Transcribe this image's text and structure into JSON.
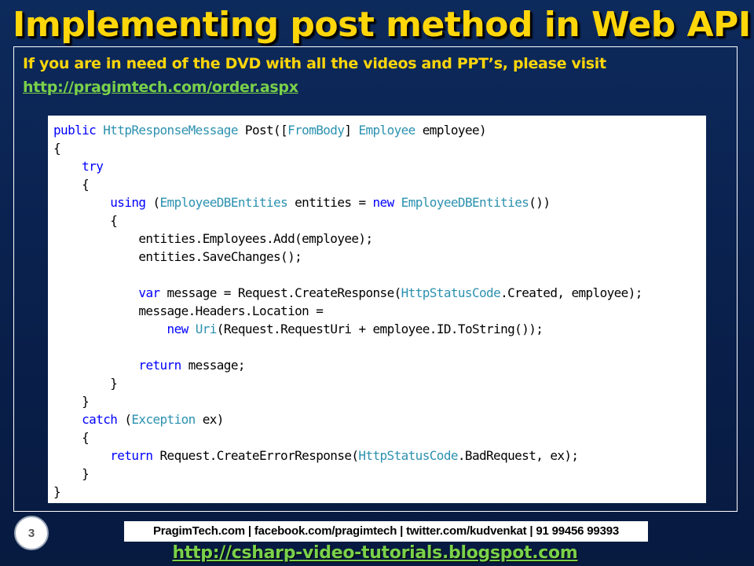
{
  "slide": {
    "title": "Implementing post method in Web API",
    "dvd_note": "If you are in need of the DVD with all the videos and PPT’s, please visit",
    "order_link": "http://pragimtech.com/order.aspx",
    "page_number": "3",
    "footer_contacts": "PragimTech.com | facebook.com/pragimtech | twitter.com/kudvenkat | 91 99456 99393",
    "footer_blog": "http://csharp-video-tutorials.blogspot.com"
  },
  "colors": {
    "title": "#ffd60a",
    "link": "#7ad14a",
    "keyword": "#0000ff",
    "type": "#2b91af",
    "background": "#0a2250"
  },
  "code": {
    "lines": [
      [
        {
          "t": "public",
          "c": "kw"
        },
        {
          "t": " "
        },
        {
          "t": "HttpResponseMessage",
          "c": "ty"
        },
        {
          "t": " Post(["
        },
        {
          "t": "FromBody",
          "c": "ty"
        },
        {
          "t": "] "
        },
        {
          "t": "Employee",
          "c": "ty"
        },
        {
          "t": " employee)"
        }
      ],
      [
        {
          "t": "{"
        }
      ],
      [
        {
          "t": "    "
        },
        {
          "t": "try",
          "c": "kw"
        }
      ],
      [
        {
          "t": "    {"
        }
      ],
      [
        {
          "t": "        "
        },
        {
          "t": "using",
          "c": "kw"
        },
        {
          "t": " ("
        },
        {
          "t": "EmployeeDBEntities",
          "c": "ty"
        },
        {
          "t": " entities = "
        },
        {
          "t": "new",
          "c": "kw"
        },
        {
          "t": " "
        },
        {
          "t": "EmployeeDBEntities",
          "c": "ty"
        },
        {
          "t": "())"
        }
      ],
      [
        {
          "t": "        {"
        }
      ],
      [
        {
          "t": "            entities.Employees.Add(employee);"
        }
      ],
      [
        {
          "t": "            entities.SaveChanges();"
        }
      ],
      [
        {
          "t": ""
        }
      ],
      [
        {
          "t": "            "
        },
        {
          "t": "var",
          "c": "kw"
        },
        {
          "t": " message = Request.CreateResponse("
        },
        {
          "t": "HttpStatusCode",
          "c": "ty"
        },
        {
          "t": ".Created, employee);"
        }
      ],
      [
        {
          "t": "            message.Headers.Location ="
        }
      ],
      [
        {
          "t": "                "
        },
        {
          "t": "new",
          "c": "kw"
        },
        {
          "t": " "
        },
        {
          "t": "Uri",
          "c": "ty"
        },
        {
          "t": "(Request.RequestUri + employee.ID.ToString());"
        }
      ],
      [
        {
          "t": ""
        }
      ],
      [
        {
          "t": "            "
        },
        {
          "t": "return",
          "c": "kw"
        },
        {
          "t": " message;"
        }
      ],
      [
        {
          "t": "        }"
        }
      ],
      [
        {
          "t": "    }"
        }
      ],
      [
        {
          "t": "    "
        },
        {
          "t": "catch",
          "c": "kw"
        },
        {
          "t": " ("
        },
        {
          "t": "Exception",
          "c": "ty"
        },
        {
          "t": " ex)"
        }
      ],
      [
        {
          "t": "    {"
        }
      ],
      [
        {
          "t": "        "
        },
        {
          "t": "return",
          "c": "kw"
        },
        {
          "t": " Request.CreateErrorResponse("
        },
        {
          "t": "HttpStatusCode",
          "c": "ty"
        },
        {
          "t": ".BadRequest, ex);"
        }
      ],
      [
        {
          "t": "    }"
        }
      ],
      [
        {
          "t": "}"
        }
      ]
    ]
  }
}
